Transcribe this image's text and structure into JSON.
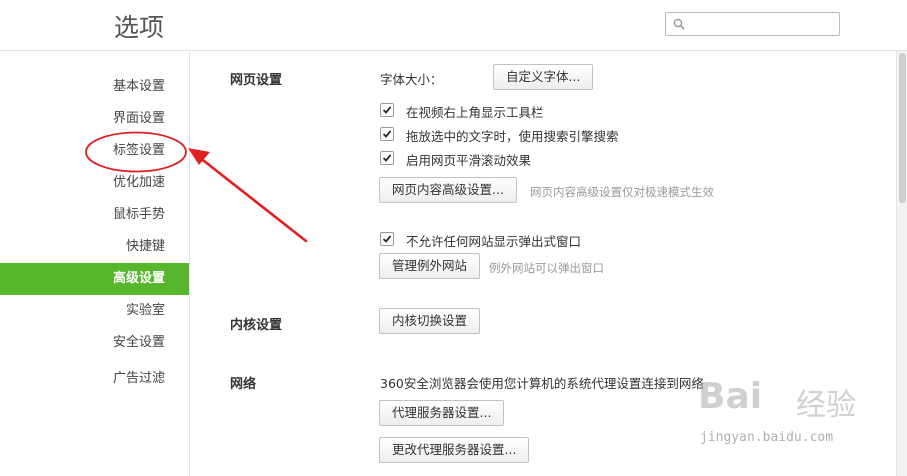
{
  "window": {
    "title": "选项"
  },
  "search": {
    "placeholder": ""
  },
  "sidebar": {
    "items": [
      {
        "label": "基本设置"
      },
      {
        "label": "界面设置"
      },
      {
        "label": "标签设置"
      },
      {
        "label": "优化加速"
      },
      {
        "label": "鼠标手势"
      },
      {
        "label": "快捷键"
      },
      {
        "label": "高级设置",
        "active": true
      },
      {
        "label": "实验室"
      },
      {
        "label": "安全设置"
      },
      {
        "label": "广告过滤"
      }
    ]
  },
  "web_settings": {
    "title": "网页设置",
    "font_size_label": "字体大小：",
    "custom_font_button": "自定义字体...",
    "options": [
      {
        "label": "在视频右上角显示工具栏",
        "checked": true
      },
      {
        "label": "拖放选中的文字时，使用搜索引擎搜索",
        "checked": true
      },
      {
        "label": "启用网页平滑滚动效果",
        "checked": true
      }
    ],
    "advanced_button": "网页内容高级设置...",
    "advanced_hint": "网页内容高级设置仅对极速模式生效",
    "popup_option": {
      "label": "不允许任何网站显示弹出式窗口",
      "checked": true
    },
    "manage_exceptions_button": "管理例外网站",
    "exceptions_hint": "例外网站可以弹出窗口"
  },
  "kernel_settings": {
    "title": "内核设置",
    "switch_button": "内核切换设置"
  },
  "network": {
    "title": "网络",
    "description": "360安全浏览器会使用您计算机的系统代理设置连接到网络",
    "proxy_button": "代理服务器设置...",
    "change_proxy_button": "更改代理服务器设置..."
  },
  "watermark": {
    "logo_a": "Bai",
    "logo_b": "经验",
    "url": "jingyan.baidu.com"
  },
  "colors": {
    "accent": "#57b72c",
    "annotation": "#e02020"
  }
}
